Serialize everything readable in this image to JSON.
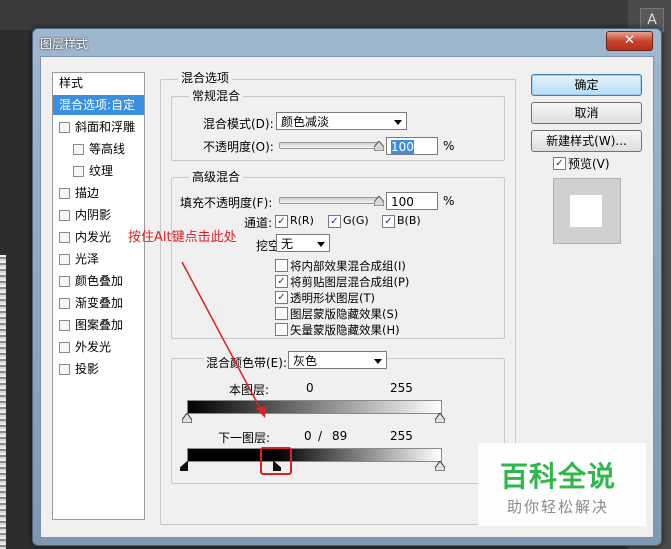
{
  "background": {
    "tool_glyph": "A"
  },
  "dialog": {
    "title": "图层样式",
    "close_glyph": "✕"
  },
  "style_list": {
    "header": "样式",
    "items": [
      {
        "label": "混合选项:自定",
        "checkbox": false,
        "selected": true,
        "indent": 0
      },
      {
        "label": "斜面和浮雕",
        "checkbox": true,
        "selected": false,
        "indent": 0
      },
      {
        "label": "等高线",
        "checkbox": true,
        "selected": false,
        "indent": 1
      },
      {
        "label": "纹理",
        "checkbox": true,
        "selected": false,
        "indent": 1
      },
      {
        "label": "描边",
        "checkbox": true,
        "selected": false,
        "indent": 0
      },
      {
        "label": "内阴影",
        "checkbox": true,
        "selected": false,
        "indent": 0
      },
      {
        "label": "内发光",
        "checkbox": true,
        "selected": false,
        "indent": 0
      },
      {
        "label": "光泽",
        "checkbox": true,
        "selected": false,
        "indent": 0
      },
      {
        "label": "颜色叠加",
        "checkbox": true,
        "selected": false,
        "indent": 0
      },
      {
        "label": "渐变叠加",
        "checkbox": true,
        "selected": false,
        "indent": 0
      },
      {
        "label": "图案叠加",
        "checkbox": true,
        "selected": false,
        "indent": 0
      },
      {
        "label": "外发光",
        "checkbox": true,
        "selected": false,
        "indent": 0
      },
      {
        "label": "投影",
        "checkbox": true,
        "selected": false,
        "indent": 0
      }
    ]
  },
  "blend": {
    "title": "混合选项",
    "general": {
      "title": "常规混合",
      "mode_label": "混合模式(D):",
      "mode_value": "颜色减淡",
      "opacity_label": "不透明度(O):",
      "opacity_value": "100",
      "opacity_unit": "%",
      "opacity_fraction": 1.0
    },
    "advanced": {
      "title": "高级混合",
      "fill_label": "填充不透明度(F):",
      "fill_value": "100",
      "fill_unit": "%",
      "fill_fraction": 1.0,
      "channels_label": "通道:",
      "channels": [
        {
          "label": "R(R)",
          "checked": true
        },
        {
          "label": "G(G)",
          "checked": true
        },
        {
          "label": "B(B)",
          "checked": true
        }
      ],
      "knockout_label": "挖空(N):",
      "knockout_value": "无",
      "options": [
        {
          "label": "将内部效果混合成组(I)",
          "checked": false
        },
        {
          "label": "将剪贴图层混合成组(P)",
          "checked": true
        },
        {
          "label": "透明形状图层(T)",
          "checked": true
        },
        {
          "label": "图层蒙版隐藏效果(S)",
          "checked": false
        },
        {
          "label": "矢量蒙版隐藏效果(H)",
          "checked": false
        }
      ]
    },
    "blend_if": {
      "label": "混合颜色带(E):",
      "value": "灰色",
      "this_layer_label": "本图层:",
      "this_layer_min": "0",
      "this_layer_max": "255",
      "underlying_label": "下一图层:",
      "underlying_min": "0",
      "underlying_sep": "/",
      "underlying_split": "89",
      "underlying_max": "255"
    }
  },
  "buttons": {
    "ok": "确定",
    "cancel": "取消",
    "new_style": "新建样式(W)...",
    "preview_label": "预览(V)",
    "preview_checked": true
  },
  "annotation": {
    "text": "按住Alt键点击此处",
    "color": "#e02020"
  },
  "watermark": {
    "title": "百科全说",
    "subtitle": "助你轻松解决",
    "color": "#2db84c"
  }
}
